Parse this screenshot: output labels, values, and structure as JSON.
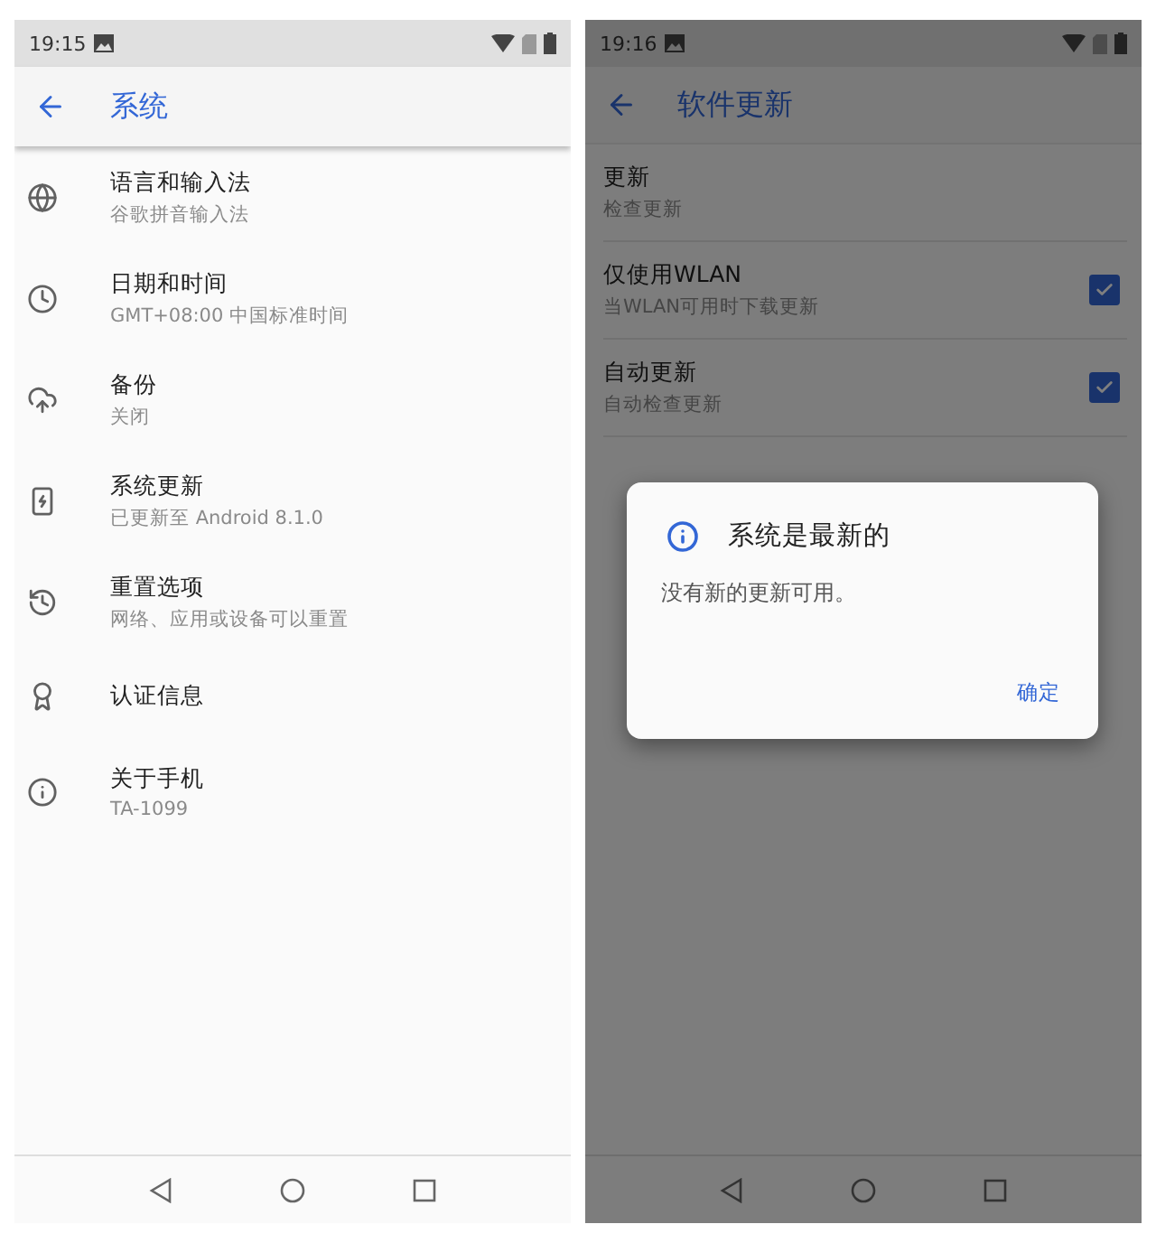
{
  "system_screen": {
    "status_bar": {
      "time": "19:15"
    },
    "toolbar": {
      "title": "系统"
    },
    "items": [
      {
        "title": "语言和输入法",
        "subtitle": "谷歌拼音输入法"
      },
      {
        "title": "日期和时间",
        "subtitle": "GMT+08:00 中国标准时间"
      },
      {
        "title": "备份",
        "subtitle": "关闭"
      },
      {
        "title": "系统更新",
        "subtitle": "已更新至 Android 8.1.0"
      },
      {
        "title": "重置选项",
        "subtitle": "网络、应用或设备可以重置"
      },
      {
        "title": "认证信息"
      },
      {
        "title": "关于手机",
        "subtitle": "TA-1099"
      }
    ]
  },
  "update_screen": {
    "status_bar": {
      "time": "19:16"
    },
    "toolbar": {
      "title": "软件更新"
    },
    "items": [
      {
        "kind": "plain",
        "title": "更新",
        "subtitle": "检查更新"
      },
      {
        "kind": "checkbox",
        "title": "仅使用WLAN",
        "subtitle": "当WLAN可用时下载更新",
        "checked": true
      },
      {
        "kind": "checkbox",
        "title": "自动更新",
        "subtitle": "自动检查更新",
        "checked": true
      }
    ],
    "dialog": {
      "title": "系统是最新的",
      "message": "没有新的更新可用。",
      "button": "确定"
    }
  }
}
